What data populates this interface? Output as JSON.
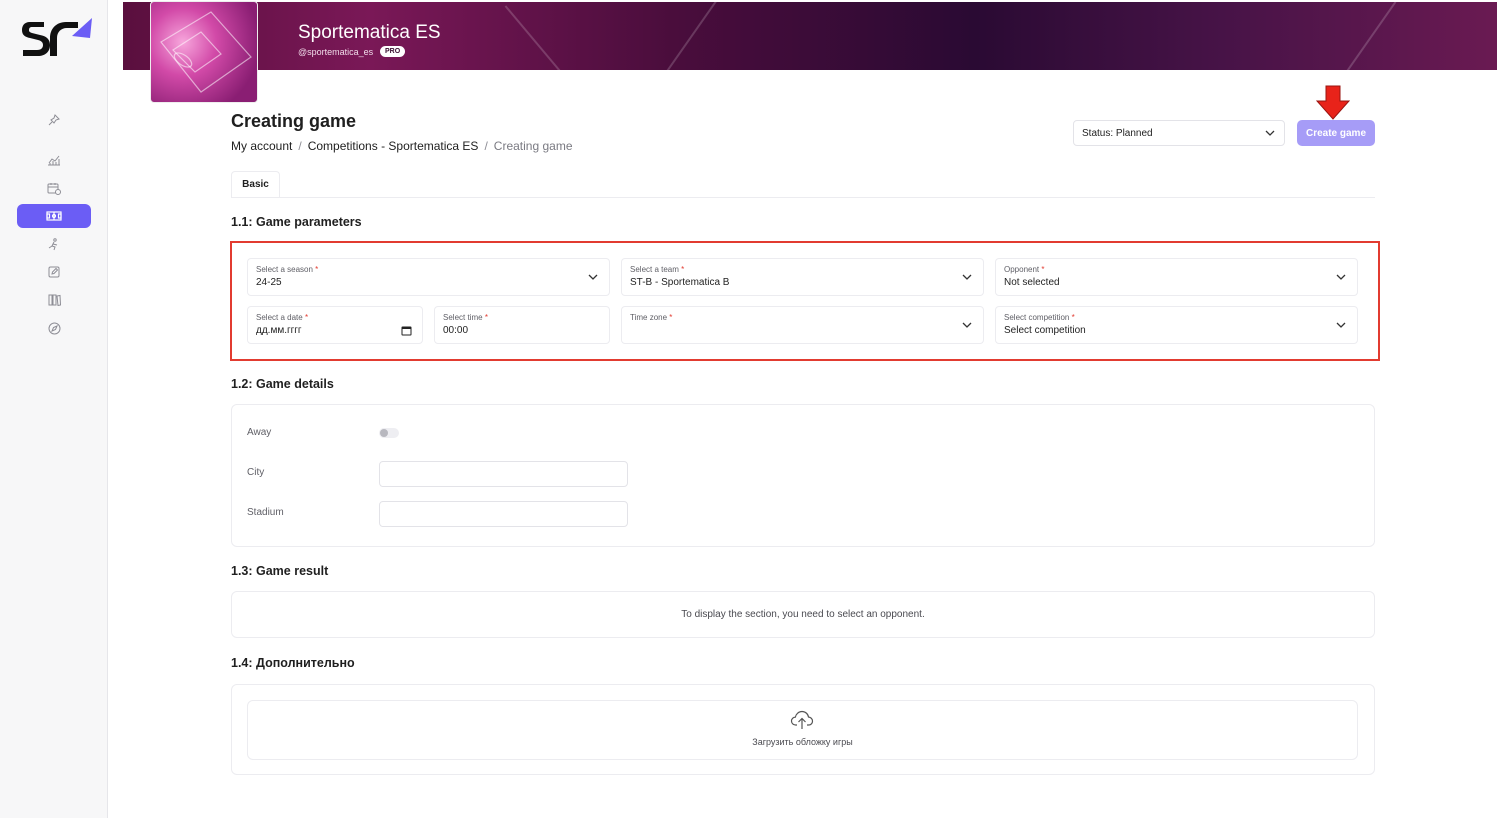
{
  "org": {
    "name": "Sportematica ES",
    "handle": "@sportematica_es",
    "badge": "PRO"
  },
  "page": {
    "title": "Creating game",
    "breadcrumb": [
      "My account",
      "Competitions - Sportematica ES",
      "Creating game"
    ]
  },
  "header": {
    "status_label": "Status: Planned",
    "create_label": "Create game"
  },
  "tabs": [
    {
      "label": "Basic",
      "active": true
    }
  ],
  "sections": {
    "params": "1.1: Game parameters",
    "details": "1.2: Game details",
    "result": "1.3: Game result",
    "extra": "1.4: Дополнительно"
  },
  "fields": {
    "season": {
      "label": "Select a season",
      "value": "24-25"
    },
    "team": {
      "label": "Select a team",
      "value": "ST-B - Sportematica B"
    },
    "opponent": {
      "label": "Opponent",
      "value": "Not selected"
    },
    "date": {
      "label": "Select a date",
      "value": "дд.мм.гггг"
    },
    "time": {
      "label": "Select time",
      "value": "00:00"
    },
    "timezone": {
      "label": "Time zone",
      "value": ""
    },
    "competition": {
      "label": "Select competition",
      "value": "Select competition"
    }
  },
  "details": {
    "away_label": "Away",
    "away_on": false,
    "city_label": "City",
    "stadium_label": "Stadium"
  },
  "result": {
    "message": "To display the section, you need to select an opponent."
  },
  "extra": {
    "upload_label": "Загрузить обложку игры"
  },
  "colors": {
    "accent": "#6b5df5",
    "create_button": "#a69cf7",
    "highlight": "#e23b30"
  },
  "icons": {
    "sidebar": [
      "pin-icon",
      "chart-icon",
      "calendar-icon",
      "field-icon",
      "runner-icon",
      "edit-icon",
      "library-icon",
      "compass-icon"
    ]
  }
}
